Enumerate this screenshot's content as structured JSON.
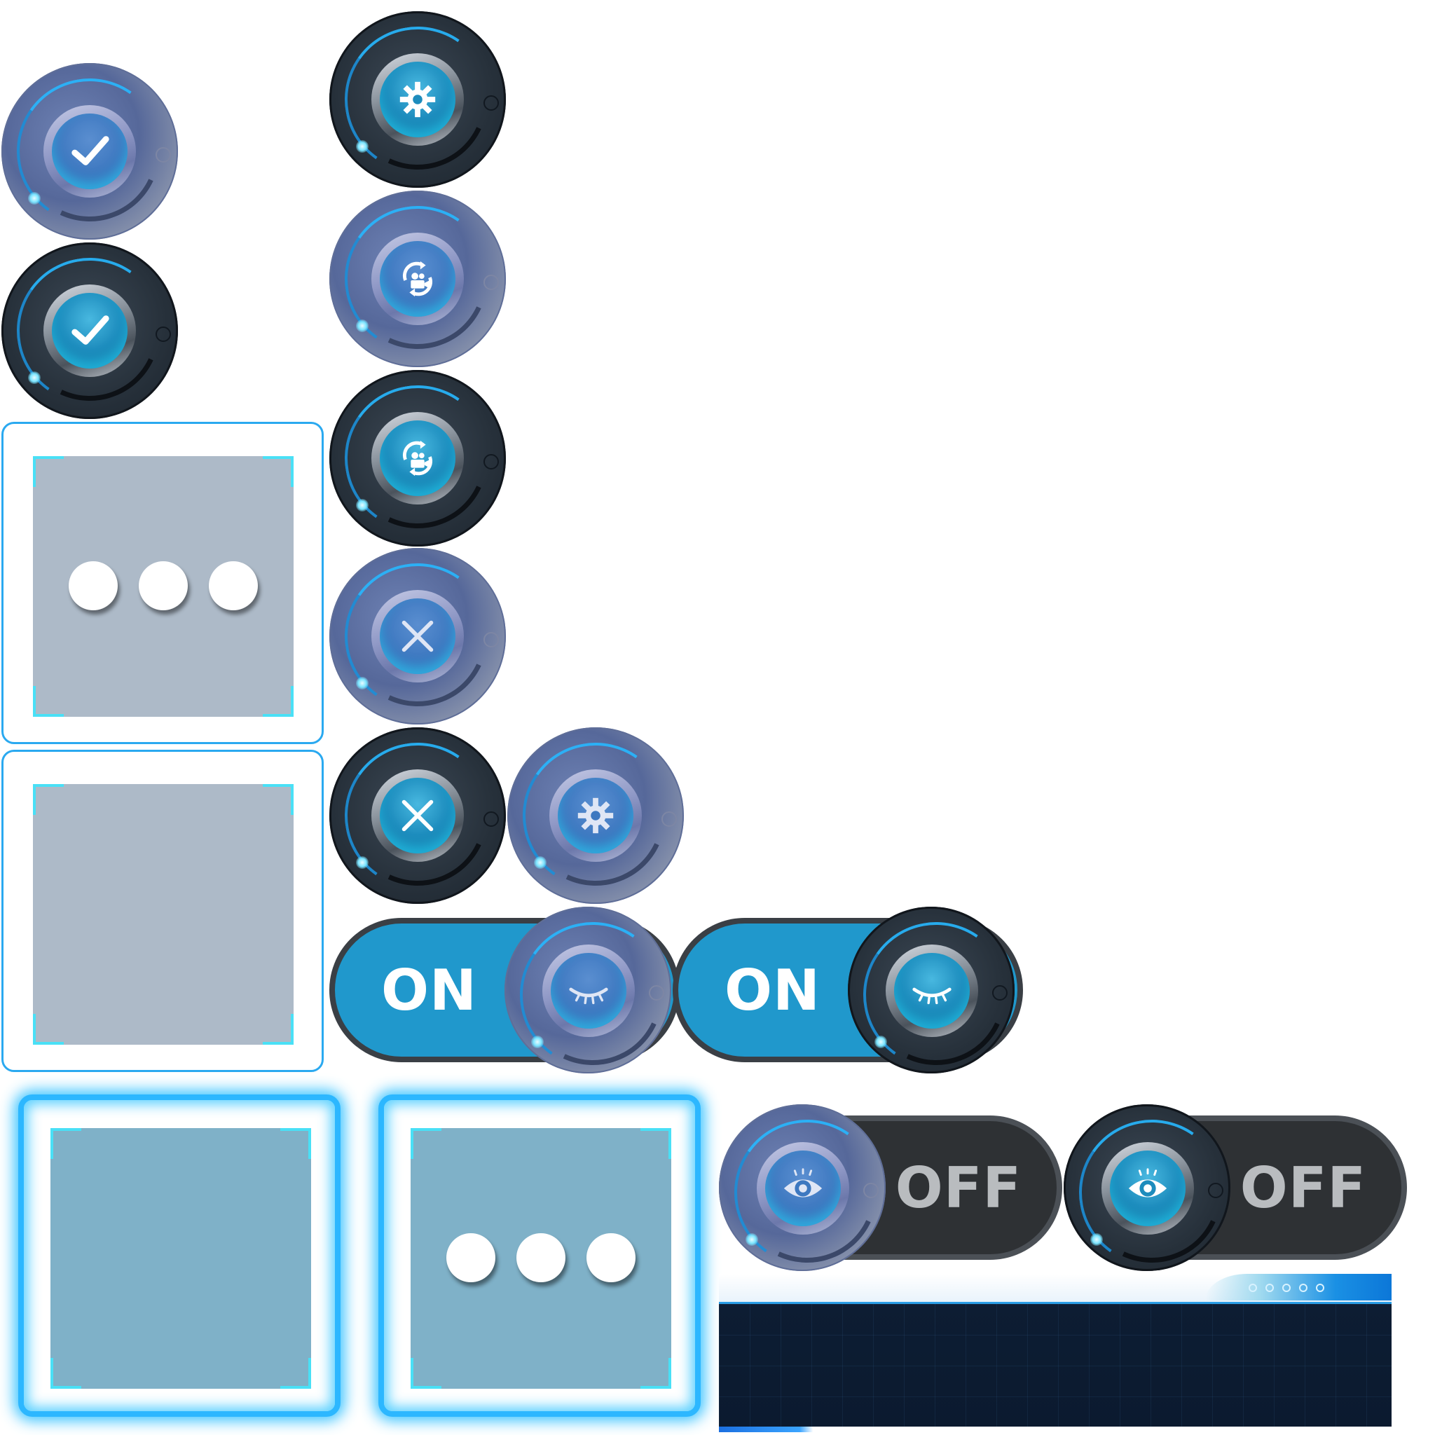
{
  "toggles": {
    "on_label": "ON",
    "off_label": "OFF"
  },
  "icons": {
    "check": "check-icon",
    "gear": "gear-icon",
    "camera_swap": "camera-swap-icon",
    "close": "close-icon",
    "eye_closed": "eye-closed-icon",
    "eye_open": "eye-open-icon",
    "more": "more-dots-icon"
  },
  "colors": {
    "accent": "#2098cc",
    "glow": "#2cb7ff",
    "dark_panel": "#0b1a2f"
  }
}
